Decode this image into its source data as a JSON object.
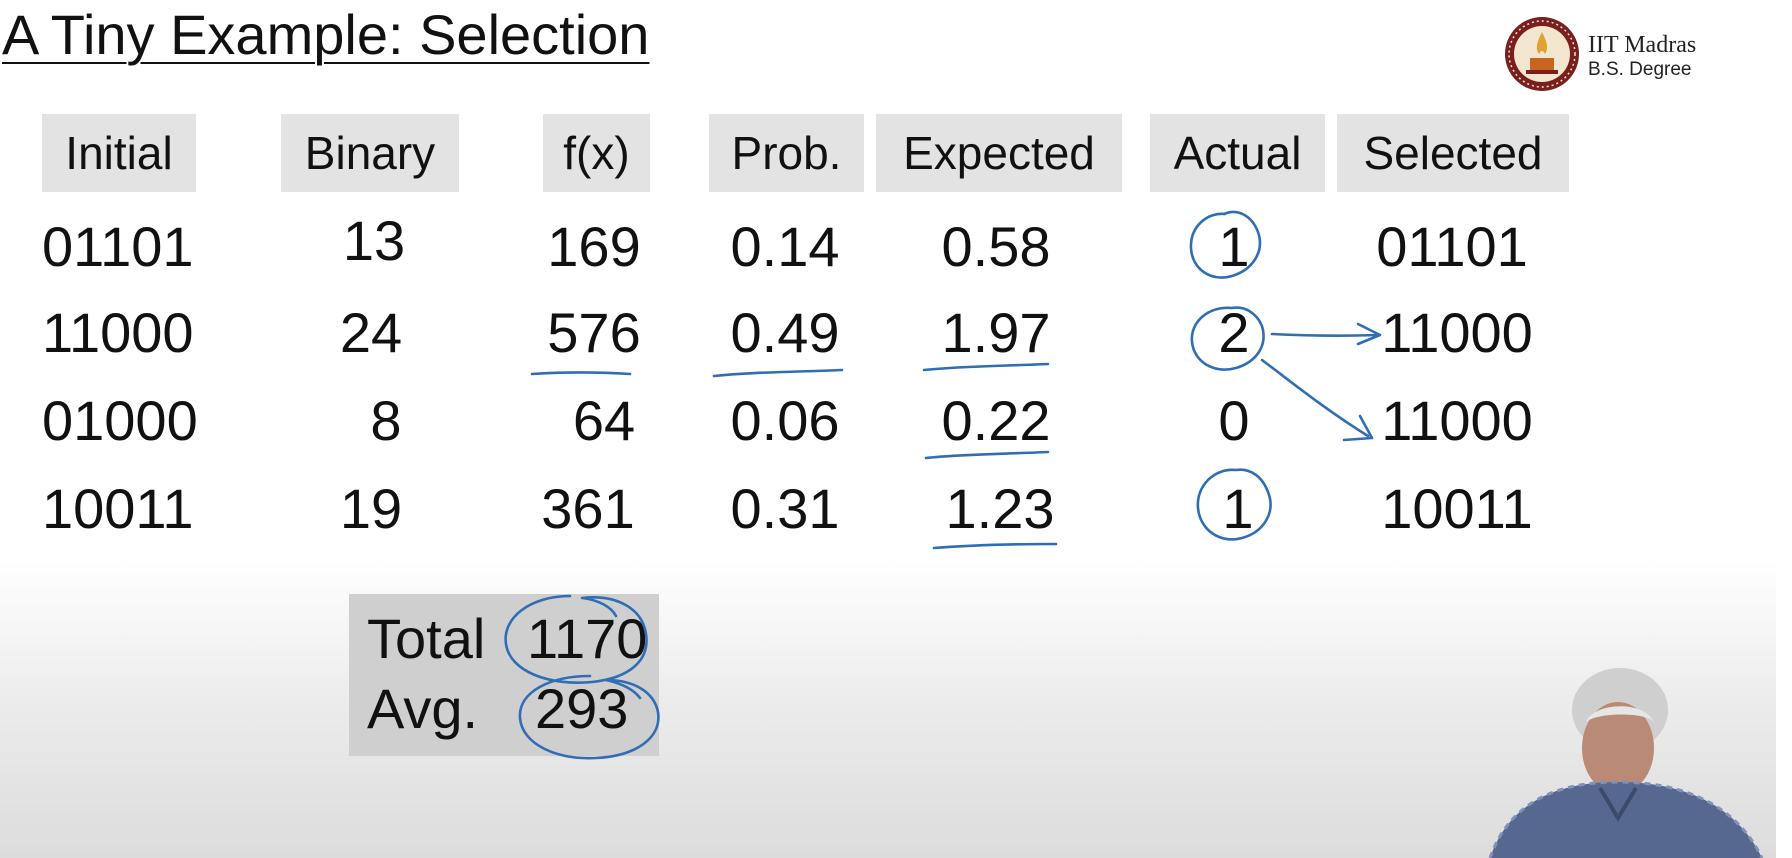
{
  "slide": {
    "title": "A Tiny Example: Selection",
    "logo": {
      "name": "IIT Madras",
      "subtitle": "B.S. Degree"
    }
  },
  "table": {
    "headers": [
      "Initial",
      "Binary",
      "f(x)",
      "Prob.",
      "Expected",
      "Actual",
      "Selected"
    ],
    "rows": [
      [
        "01101",
        "13",
        "169",
        "0.14",
        "0.58",
        "1",
        "01101"
      ],
      [
        "11000",
        "24",
        "576",
        "0.49",
        "1.97",
        "2",
        "11000"
      ],
      [
        "01000",
        "8",
        "64",
        "0.06",
        "0.22",
        "0",
        "11000"
      ],
      [
        "10011",
        "19",
        "361",
        "0.31",
        "1.23",
        "1",
        "10011"
      ]
    ]
  },
  "summary": {
    "total_label": "Total",
    "total_value": "1170",
    "avg_label": "Avg.",
    "avg_value": "293"
  },
  "colors": {
    "ink": "#2f6db5",
    "header_bg": "#e3e3e3",
    "summary_bg": "#cfcfcf"
  },
  "icons": [
    "iit-madras-emblem-icon",
    "presenter-video-icon"
  ]
}
